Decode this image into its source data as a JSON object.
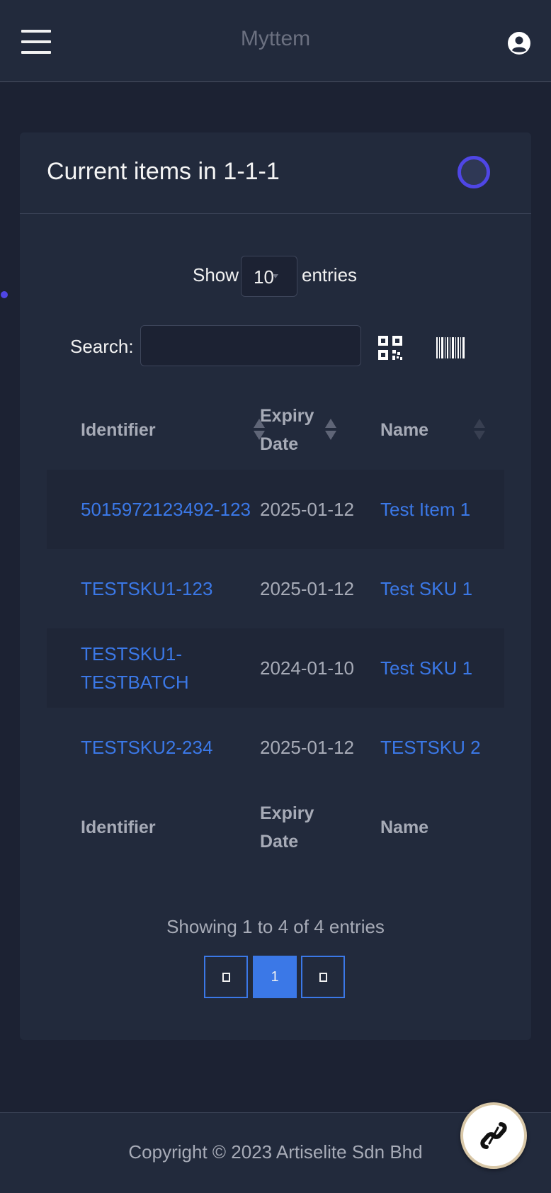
{
  "app": {
    "title": "Myttem"
  },
  "header": {
    "menu_icon": "hamburger-menu-icon",
    "user_icon": "user-circle-icon"
  },
  "card": {
    "title": "Current items in 1-1-1"
  },
  "length": {
    "show_label": "Show",
    "value": "10",
    "entries_label": "entries"
  },
  "search": {
    "label": "Search:",
    "value": "",
    "qr_icon": "qr-code-icon",
    "barcode_icon": "barcode-icon"
  },
  "table": {
    "headers": {
      "identifier": "Identifier",
      "expiry": "Expiry Date",
      "name": "Name"
    },
    "rows": [
      {
        "identifier": "5015972123492-123",
        "expiry": "2025-01-12",
        "name": "Test Item 1"
      },
      {
        "identifier": "TESTSKU1-123",
        "expiry": "2025-01-12",
        "name": "Test SKU 1"
      },
      {
        "identifier": "TESTSKU1-TESTBATCH",
        "expiry": "2024-01-10",
        "name": "Test SKU 1"
      },
      {
        "identifier": "TESTSKU2-234",
        "expiry": "2025-01-12",
        "name": "TESTSKU 2"
      }
    ]
  },
  "info": {
    "text": "Showing 1 to 4 of 4 entries"
  },
  "pagination": {
    "current": "1"
  },
  "footer": {
    "copyright": "Copyright © 2023 Artiselite Sdn Bhd"
  },
  "colors": {
    "accent": "#3b78e7",
    "spinner": "#4f46e5",
    "background": "#1c2233",
    "card": "#222a3c"
  }
}
